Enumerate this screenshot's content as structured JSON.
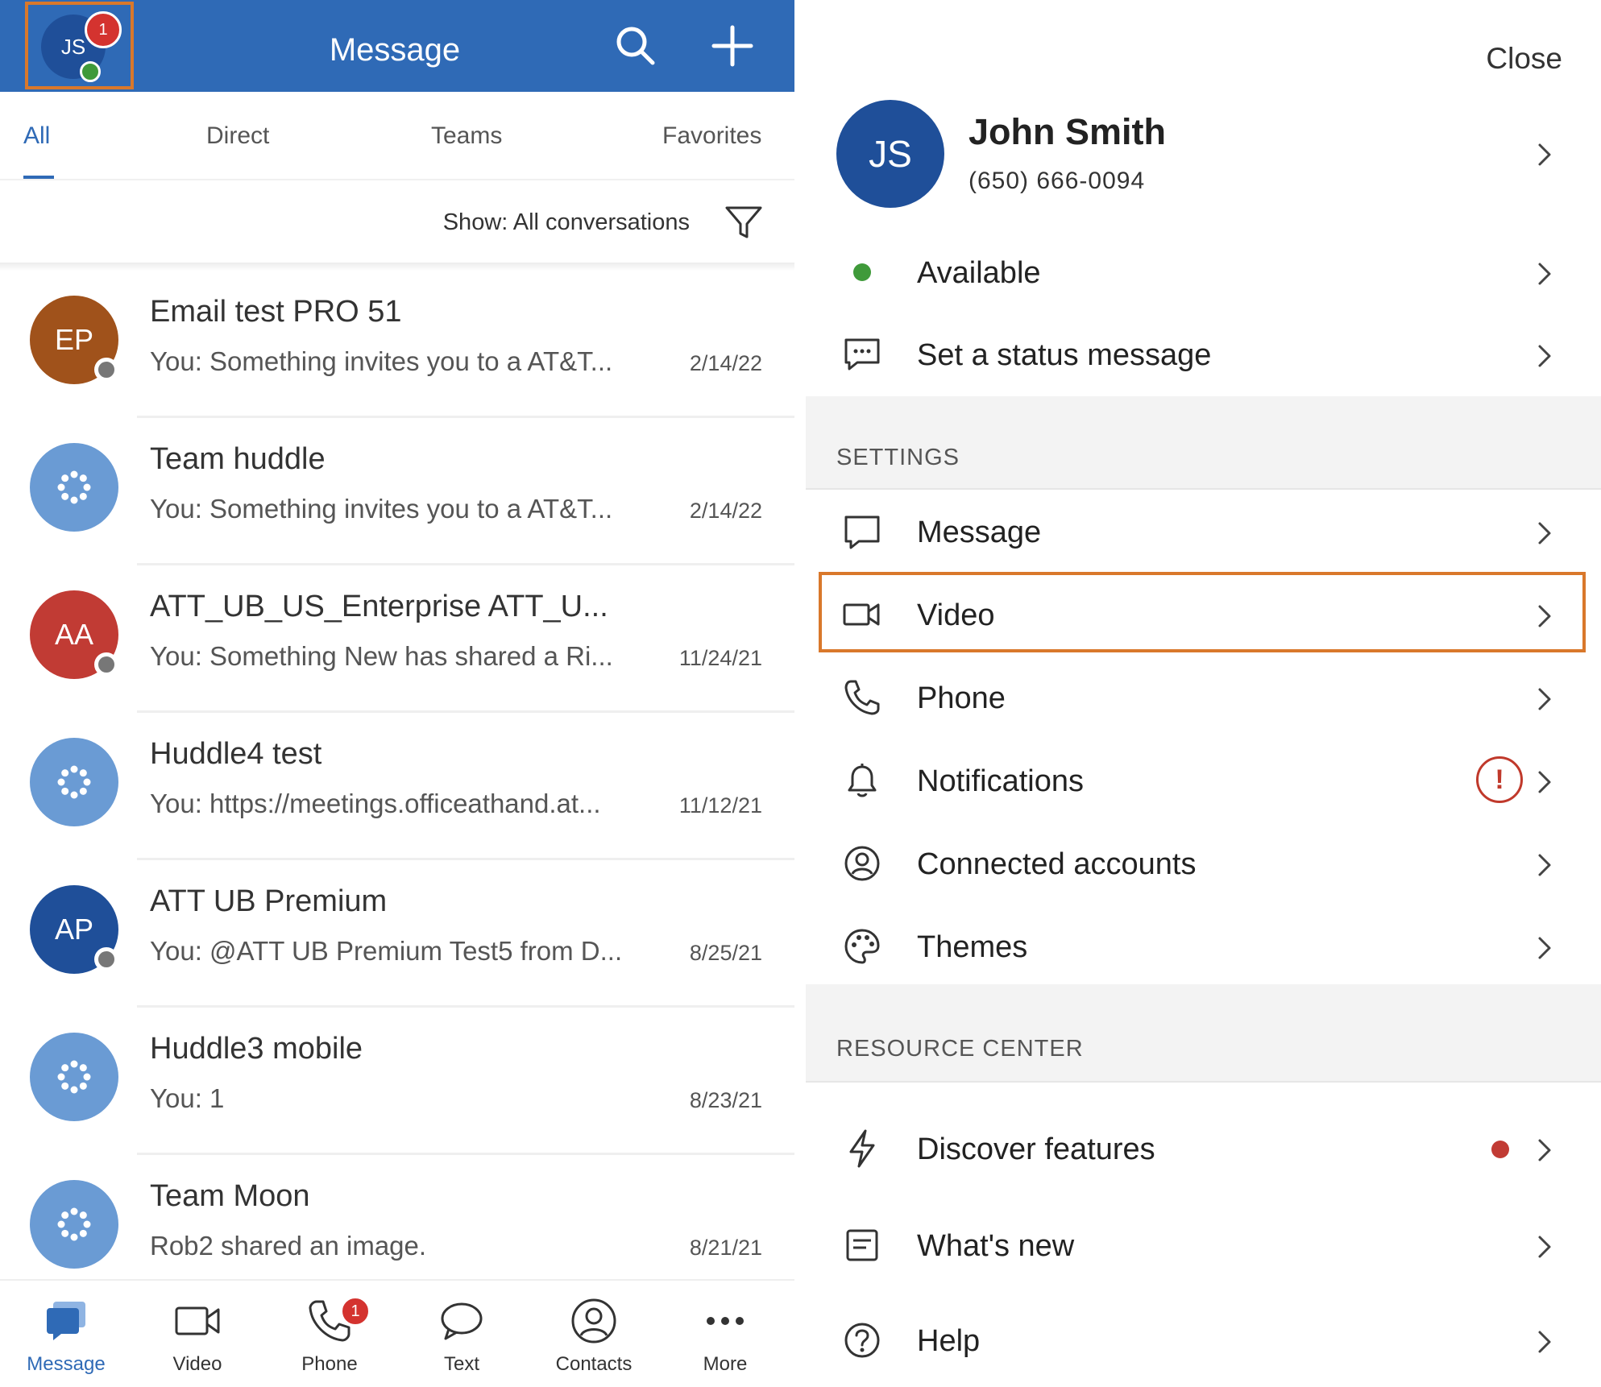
{
  "header": {
    "title": "Message",
    "avatar_initials": "JS",
    "avatar_badge": "1"
  },
  "tabs": [
    {
      "label": "All"
    },
    {
      "label": "Direct"
    },
    {
      "label": "Teams"
    },
    {
      "label": "Favorites"
    }
  ],
  "filter": {
    "show_label": "Show: All conversations"
  },
  "conversations": [
    {
      "initials": "EP",
      "avatar_color": "#a0521b",
      "type": "person",
      "name": "Email test PRO 51",
      "preview": "You: Something invites you to a AT&T...",
      "date": "2/14/22"
    },
    {
      "initials": "",
      "avatar_color": "#6a9bd4",
      "type": "team",
      "name": "Team huddle",
      "preview": "You: Something invites you to a AT&T...",
      "date": "2/14/22"
    },
    {
      "initials": "AA",
      "avatar_color": "#c13b34",
      "type": "person",
      "name": "ATT_UB_US_Enterprise ATT_U...",
      "preview": "You: Something New has shared a Ri...",
      "date": "11/24/21"
    },
    {
      "initials": "",
      "avatar_color": "#6a9bd4",
      "type": "team",
      "name": "Huddle4 test",
      "preview": "You: https://meetings.officeathand.at...",
      "date": "11/12/21"
    },
    {
      "initials": "AP",
      "avatar_color": "#1f4f99",
      "type": "person",
      "name": "ATT UB Premium",
      "preview": "You: @ATT UB Premium Test5 from D...",
      "date": "8/25/21"
    },
    {
      "initials": "",
      "avatar_color": "#6a9bd4",
      "type": "team",
      "name": "Huddle3 mobile",
      "preview": "You: 1",
      "date": "8/23/21"
    },
    {
      "initials": "",
      "avatar_color": "#6a9bd4",
      "type": "team",
      "name": "Team Moon",
      "preview": "Rob2 shared an image.",
      "date": "8/21/21"
    }
  ],
  "bottom_nav": [
    {
      "label": "Message",
      "icon": "message-icon"
    },
    {
      "label": "Video",
      "icon": "video-icon"
    },
    {
      "label": "Phone",
      "icon": "phone-icon",
      "badge": "1"
    },
    {
      "label": "Text",
      "icon": "text-icon"
    },
    {
      "label": "Contacts",
      "icon": "contacts-icon"
    },
    {
      "label": "More",
      "icon": "more-icon"
    }
  ],
  "panel": {
    "close_label": "Close",
    "profile": {
      "initials": "JS",
      "name": "John Smith",
      "phone": "(650) 666-0094"
    },
    "status": {
      "available_label": "Available",
      "status_message_label": "Set a status message"
    },
    "settings_title": "SETTINGS",
    "settings": [
      {
        "label": "Message",
        "icon": "message-icon"
      },
      {
        "label": "Video",
        "icon": "video-icon"
      },
      {
        "label": "Phone",
        "icon": "phone-icon"
      },
      {
        "label": "Notifications",
        "icon": "bell-icon",
        "alert": "!"
      },
      {
        "label": "Connected accounts",
        "icon": "account-icon"
      },
      {
        "label": "Themes",
        "icon": "palette-icon"
      }
    ],
    "resource_title": "RESOURCE CENTER",
    "resources": [
      {
        "label": "Discover features",
        "icon": "lightning-icon"
      },
      {
        "label": "What's new",
        "icon": "document-icon"
      },
      {
        "label": "Help",
        "icon": "help-icon"
      }
    ]
  },
  "colors": {
    "brand": "#2f6ab6",
    "highlight": "#d9782b",
    "badge": "#d4332f",
    "available": "#3f9a3a"
  }
}
